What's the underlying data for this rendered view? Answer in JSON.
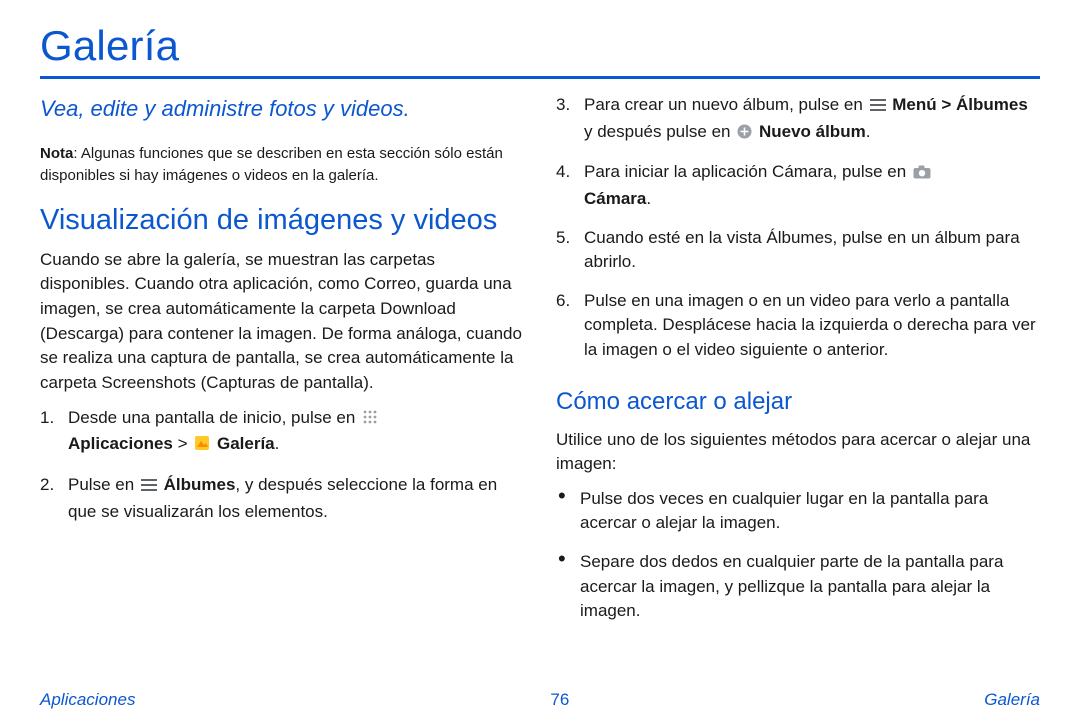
{
  "header": {
    "title": "Galería"
  },
  "left": {
    "lead": "Vea, edite y administre fotos y videos.",
    "note_label": "Nota",
    "note_body": ": Algunas funciones que se describen en esta sección sólo están disponibles si hay imágenes o videos en la galería.",
    "h2": "Visualización de imágenes y videos",
    "intro": "Cuando se abre la galería, se muestran las carpetas disponibles. Cuando otra aplicación, como Correo, guarda una imagen, se crea automáticamente la carpeta Download (Descarga) para contener la imagen. De forma análoga, cuando se realiza una captura de pantalla, se crea automáticamente la carpeta Screenshots (Capturas de pantalla).",
    "s1_a": "Desde una pantalla de inicio, pulse en ",
    "s1_b": "Aplicaciones",
    "s1_c": " > ",
    "s1_d": " Galería",
    "s1_e": ".",
    "s2_a": "Pulse en ",
    "s2_b": " Álbumes",
    "s2_c": ", y después seleccione la forma en que se visualizarán los elementos."
  },
  "right": {
    "s3_a": "Para crear un nuevo álbum, pulse en ",
    "s3_b": " Menú > Álbumes",
    "s3_c": " y después pulse en ",
    "s3_d": " Nuevo álbum",
    "s3_e": ".",
    "s4_a": "Para iniciar la aplicación Cámara, pulse en ",
    "s4_b": "Cámara",
    "s4_c": ".",
    "s5": "Cuando esté en la vista Álbumes, pulse en un álbum para abrirlo.",
    "s6": "Pulse en una imagen o en un video para verlo a pantalla completa. Desplácese hacia la izquierda o derecha para ver la imagen o el video siguiente o anterior.",
    "h3": "Cómo acercar o alejar",
    "zoom_intro": "Utilice uno de los siguientes métodos para acercar o alejar una imagen:",
    "b1": "Pulse dos veces en cualquier lugar en la pantalla para acercar o alejar la imagen.",
    "b2": "Separe dos dedos en cualquier parte de la pantalla para acercar la imagen, y pellizque la pantalla para alejar la imagen."
  },
  "footer": {
    "left": "Aplicaciones",
    "page": "76",
    "right": "Galería"
  }
}
